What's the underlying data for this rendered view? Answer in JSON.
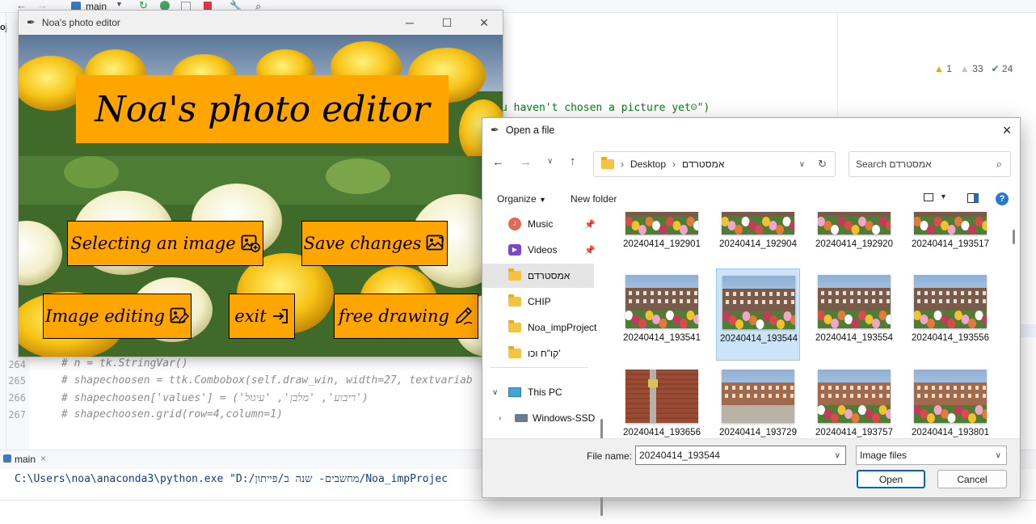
{
  "ide": {
    "branch": "main",
    "inspections": {
      "errors": "1",
      "warnings": "33",
      "ok": "24"
    },
    "gutter_lines": [
      "264",
      "265",
      "266",
      "267"
    ],
    "code_lines": [
      "u haven't chosen a picture yet☺\")",
      "# n = tk.StringVar()",
      "# shapechoosen = ttk.Combobox(self.draw_win, width=27, textvariab",
      "# shapechoosen['values'] = ('ריבוע', 'מלבן', 'עיגול')",
      "# shapechoosen.grid(row=4,column=1)"
    ],
    "run_tab": "main",
    "console_line": "C:\\Users\\noa\\anaconda3\\python.exe \"D:/מחשבים- שנה ב/פייתון/Noa_impProjec",
    "left_project_label": "ojec"
  },
  "app": {
    "window_title": "Noa's photo editor",
    "heading": "Noa's photo editor",
    "buttons": {
      "select": "Selecting an image",
      "save": "Save changes",
      "edit": "Image editing",
      "exit": "exit",
      "draw": "free drawing"
    },
    "colors": {
      "accent": "#ffa500"
    }
  },
  "dialog": {
    "title": "Open a file",
    "breadcrumb": [
      "Desktop",
      "אמסטרדם"
    ],
    "search_placeholder": "Search אמסטרדם",
    "organize": "Organize",
    "new_folder": "New folder",
    "nav": {
      "music": "Music",
      "videos": "Videos",
      "amsterdam": "אמסטרדם",
      "chip": "CHIP",
      "noa": "Noa_impProject",
      "cv": "קו\"ח וכו'",
      "thispc": "This PC",
      "drive": "Windows-SSD"
    },
    "files": [
      "20240414_192901",
      "20240414_192904",
      "20240414_192920",
      "20240414_193517",
      "20240414_193541",
      "20240414_193544",
      "20240414_193554",
      "20240414_193556",
      "20240414_193656",
      "20240414_193729",
      "20240414_193757",
      "20240414_193801"
    ],
    "selected_file": "20240414_193544",
    "file_name_label": "File name:",
    "file_name_value": "20240414_193544",
    "filter": "Image files",
    "open_button": "Open",
    "cancel_button": "Cancel"
  }
}
